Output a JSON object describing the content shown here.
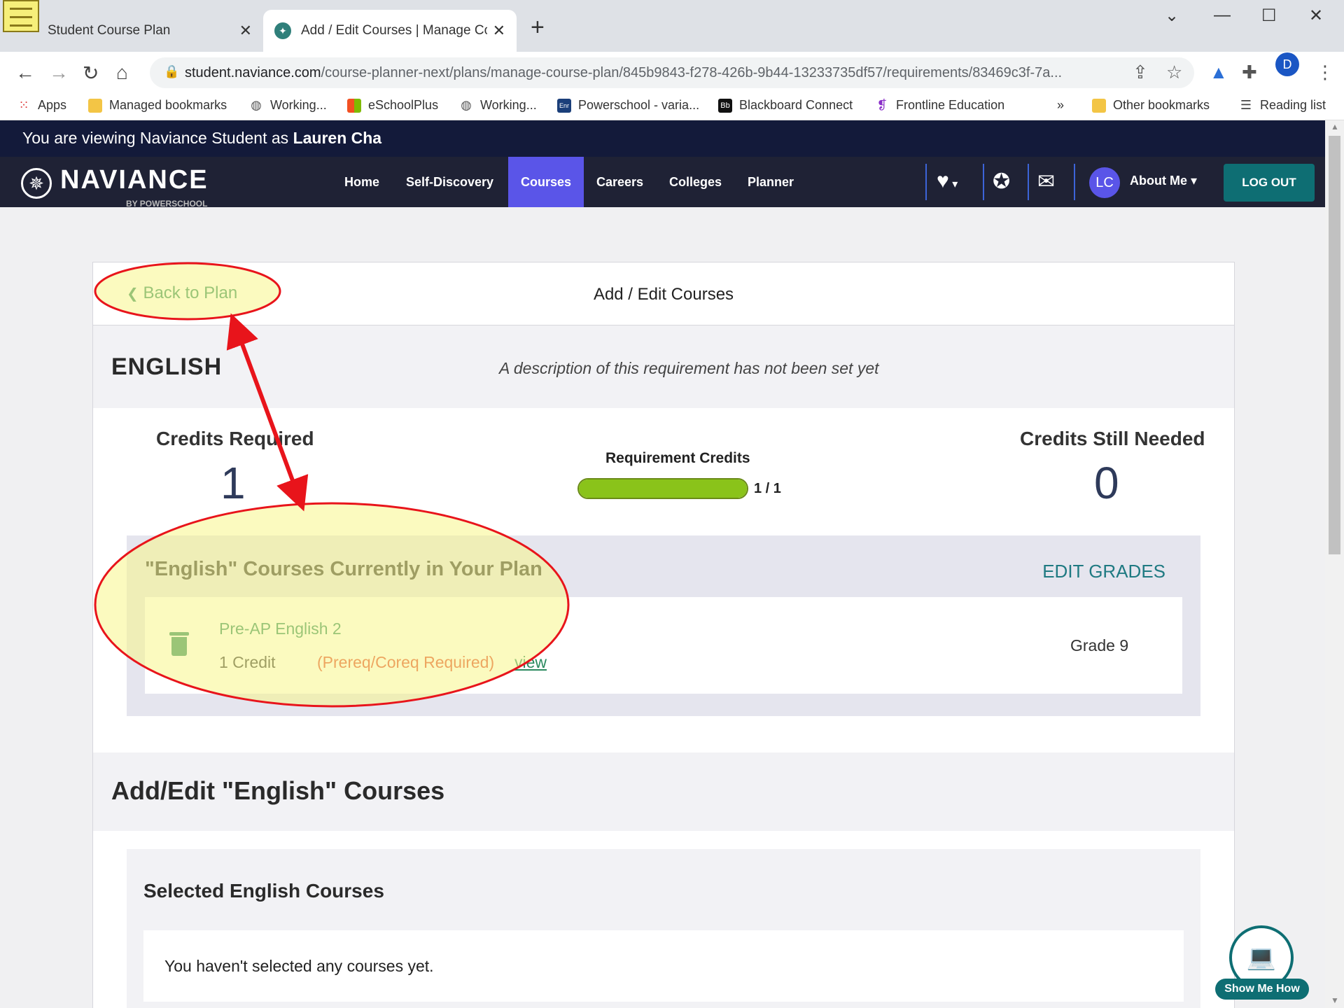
{
  "browser": {
    "tabs": [
      {
        "title": "Student Course Plan",
        "active": false
      },
      {
        "title": "Add / Edit Courses | Manage Cou",
        "active": true
      }
    ],
    "url_host": "student.naviance.com",
    "url_path": "/course-planner-next/plans/manage-course-plan/845b9843-f278-426b-9b44-13233735df57/requirements/83469c3f-7a...",
    "profile_initial": "D",
    "bookmarks": {
      "apps": "Apps",
      "managed": "Managed bookmarks",
      "working1": "Working...",
      "eschoolplus": "eSchoolPlus",
      "working2": "Working...",
      "powerschool": "Powerschool - varia...",
      "blackboard": "Blackboard Connect",
      "frontline": "Frontline Education",
      "more": "»",
      "other": "Other bookmarks",
      "reading": "Reading list"
    }
  },
  "app": {
    "viewing_prefix": "You are viewing Naviance Student as ",
    "viewing_user": "Lauren Cha",
    "logo_word": "NAVIANCE",
    "logo_by": "BY POWERSCHOOL",
    "nav": {
      "home": "Home",
      "self_discovery": "Self-Discovery",
      "courses": "Courses",
      "careers": "Careers",
      "colleges": "Colleges",
      "planner": "Planner"
    },
    "avatar_initials": "LC",
    "about_me": "About Me ▾",
    "logout": "LOG OUT"
  },
  "page": {
    "back": "Back to Plan",
    "title": "Add / Edit Courses",
    "requirement": "ENGLISH",
    "description": "A description of this requirement has not been set yet",
    "credits_required_label": "Credits Required",
    "credits_required": "1",
    "requirement_credits_label": "Requirement Credits",
    "progress_fraction": 1.0,
    "progress_text": "1 / 1",
    "credits_needed_label": "Credits Still Needed",
    "credits_needed": "0",
    "in_plan_title": "\"English\" Courses Currently in Your Plan",
    "edit_grades": "EDIT GRADES",
    "course": {
      "name": "Pre-AP English 2",
      "credit": "1 Credit",
      "prereq": "(Prereq/Coreq Required)",
      "view": "view",
      "grade": "Grade 9"
    },
    "add_edit_title": "Add/Edit \"English\" Courses",
    "selected_title": "Selected English Courses",
    "empty_msg": "You haven't selected any courses yet.",
    "show_me_how": "Show Me How"
  },
  "colors": {
    "annotation": "#e8141b",
    "highlight": "#f8f58a",
    "accent": "#5a55e8",
    "green": "#2a8a5f",
    "teal": "#0e6e73"
  }
}
